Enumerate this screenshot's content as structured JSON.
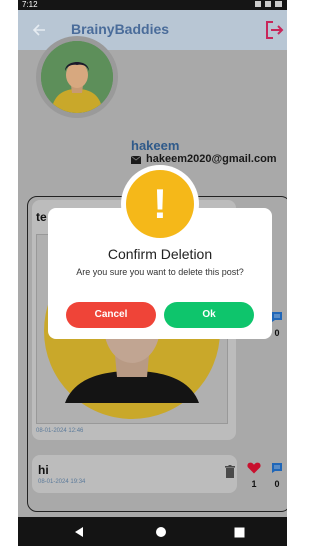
{
  "status_bar": {
    "left": "7:12",
    "right": ""
  },
  "app_bar": {
    "title": "BrainyBaddies"
  },
  "profile": {
    "username": "hakeem",
    "email": "hakeem2020@gmail.com"
  },
  "posts": [
    {
      "title": "te",
      "date": "08-01-2024 12:46",
      "likes": "",
      "comments": "0"
    },
    {
      "title": "hi",
      "date": "08-01-2024 19:34",
      "likes": "1",
      "comments": "0"
    }
  ],
  "dialog": {
    "title": "Confirm Deletion",
    "message": "Are you sure you want to delete this post?",
    "cancel_label": "Cancel",
    "ok_label": "Ok",
    "icon": "exclamation-icon"
  },
  "colors": {
    "appbar_bg": "#b8c6d4",
    "title_color": "#4a6c9a",
    "cancel_red": "#ef4438",
    "ok_green": "#0ec56c",
    "alert_yellow": "#f5b819",
    "logout_magenta": "#c8265a",
    "like_red": "#c8102e",
    "comment_blue": "#1f66b8"
  }
}
